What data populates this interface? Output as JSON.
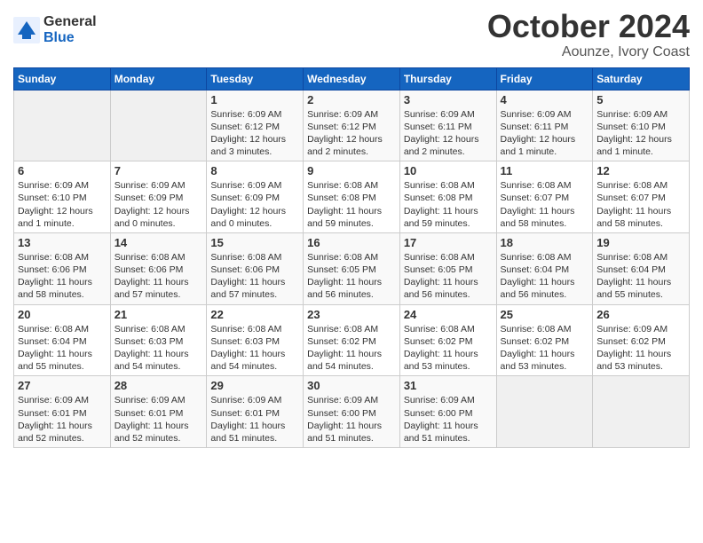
{
  "header": {
    "logo_general": "General",
    "logo_blue": "Blue",
    "month_title": "October 2024",
    "location": "Aounze, Ivory Coast"
  },
  "weekdays": [
    "Sunday",
    "Monday",
    "Tuesday",
    "Wednesday",
    "Thursday",
    "Friday",
    "Saturday"
  ],
  "weeks": [
    [
      {
        "day": "",
        "info": ""
      },
      {
        "day": "",
        "info": ""
      },
      {
        "day": "1",
        "info": "Sunrise: 6:09 AM\nSunset: 6:12 PM\nDaylight: 12 hours\nand 3 minutes."
      },
      {
        "day": "2",
        "info": "Sunrise: 6:09 AM\nSunset: 6:12 PM\nDaylight: 12 hours\nand 2 minutes."
      },
      {
        "day": "3",
        "info": "Sunrise: 6:09 AM\nSunset: 6:11 PM\nDaylight: 12 hours\nand 2 minutes."
      },
      {
        "day": "4",
        "info": "Sunrise: 6:09 AM\nSunset: 6:11 PM\nDaylight: 12 hours\nand 1 minute."
      },
      {
        "day": "5",
        "info": "Sunrise: 6:09 AM\nSunset: 6:10 PM\nDaylight: 12 hours\nand 1 minute."
      }
    ],
    [
      {
        "day": "6",
        "info": "Sunrise: 6:09 AM\nSunset: 6:10 PM\nDaylight: 12 hours\nand 1 minute."
      },
      {
        "day": "7",
        "info": "Sunrise: 6:09 AM\nSunset: 6:09 PM\nDaylight: 12 hours\nand 0 minutes."
      },
      {
        "day": "8",
        "info": "Sunrise: 6:09 AM\nSunset: 6:09 PM\nDaylight: 12 hours\nand 0 minutes."
      },
      {
        "day": "9",
        "info": "Sunrise: 6:08 AM\nSunset: 6:08 PM\nDaylight: 11 hours\nand 59 minutes."
      },
      {
        "day": "10",
        "info": "Sunrise: 6:08 AM\nSunset: 6:08 PM\nDaylight: 11 hours\nand 59 minutes."
      },
      {
        "day": "11",
        "info": "Sunrise: 6:08 AM\nSunset: 6:07 PM\nDaylight: 11 hours\nand 58 minutes."
      },
      {
        "day": "12",
        "info": "Sunrise: 6:08 AM\nSunset: 6:07 PM\nDaylight: 11 hours\nand 58 minutes."
      }
    ],
    [
      {
        "day": "13",
        "info": "Sunrise: 6:08 AM\nSunset: 6:06 PM\nDaylight: 11 hours\nand 58 minutes."
      },
      {
        "day": "14",
        "info": "Sunrise: 6:08 AM\nSunset: 6:06 PM\nDaylight: 11 hours\nand 57 minutes."
      },
      {
        "day": "15",
        "info": "Sunrise: 6:08 AM\nSunset: 6:06 PM\nDaylight: 11 hours\nand 57 minutes."
      },
      {
        "day": "16",
        "info": "Sunrise: 6:08 AM\nSunset: 6:05 PM\nDaylight: 11 hours\nand 56 minutes."
      },
      {
        "day": "17",
        "info": "Sunrise: 6:08 AM\nSunset: 6:05 PM\nDaylight: 11 hours\nand 56 minutes."
      },
      {
        "day": "18",
        "info": "Sunrise: 6:08 AM\nSunset: 6:04 PM\nDaylight: 11 hours\nand 56 minutes."
      },
      {
        "day": "19",
        "info": "Sunrise: 6:08 AM\nSunset: 6:04 PM\nDaylight: 11 hours\nand 55 minutes."
      }
    ],
    [
      {
        "day": "20",
        "info": "Sunrise: 6:08 AM\nSunset: 6:04 PM\nDaylight: 11 hours\nand 55 minutes."
      },
      {
        "day": "21",
        "info": "Sunrise: 6:08 AM\nSunset: 6:03 PM\nDaylight: 11 hours\nand 54 minutes."
      },
      {
        "day": "22",
        "info": "Sunrise: 6:08 AM\nSunset: 6:03 PM\nDaylight: 11 hours\nand 54 minutes."
      },
      {
        "day": "23",
        "info": "Sunrise: 6:08 AM\nSunset: 6:02 PM\nDaylight: 11 hours\nand 54 minutes."
      },
      {
        "day": "24",
        "info": "Sunrise: 6:08 AM\nSunset: 6:02 PM\nDaylight: 11 hours\nand 53 minutes."
      },
      {
        "day": "25",
        "info": "Sunrise: 6:08 AM\nSunset: 6:02 PM\nDaylight: 11 hours\nand 53 minutes."
      },
      {
        "day": "26",
        "info": "Sunrise: 6:09 AM\nSunset: 6:02 PM\nDaylight: 11 hours\nand 53 minutes."
      }
    ],
    [
      {
        "day": "27",
        "info": "Sunrise: 6:09 AM\nSunset: 6:01 PM\nDaylight: 11 hours\nand 52 minutes."
      },
      {
        "day": "28",
        "info": "Sunrise: 6:09 AM\nSunset: 6:01 PM\nDaylight: 11 hours\nand 52 minutes."
      },
      {
        "day": "29",
        "info": "Sunrise: 6:09 AM\nSunset: 6:01 PM\nDaylight: 11 hours\nand 51 minutes."
      },
      {
        "day": "30",
        "info": "Sunrise: 6:09 AM\nSunset: 6:00 PM\nDaylight: 11 hours\nand 51 minutes."
      },
      {
        "day": "31",
        "info": "Sunrise: 6:09 AM\nSunset: 6:00 PM\nDaylight: 11 hours\nand 51 minutes."
      },
      {
        "day": "",
        "info": ""
      },
      {
        "day": "",
        "info": ""
      }
    ]
  ]
}
